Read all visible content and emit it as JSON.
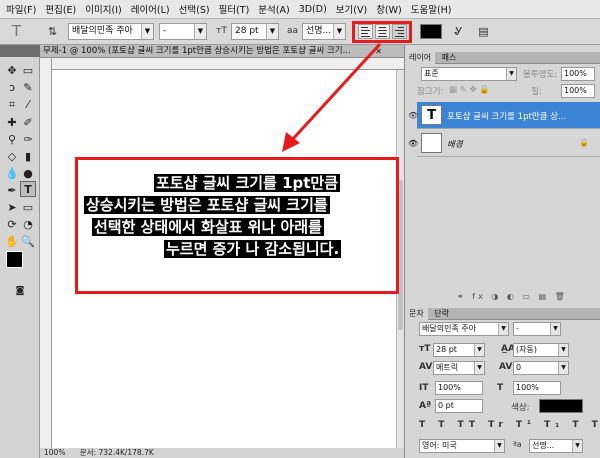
{
  "menu": [
    "파일(F)",
    "편집(E)",
    "이미지(I)",
    "레이어(L)",
    "선택(S)",
    "필터(T)",
    "분석(A)",
    "3D(D)",
    "보기(V)",
    "창(W)",
    "도움말(H)"
  ],
  "options_bar": {
    "font_family": "배달의민족 주아",
    "font_style": "-",
    "font_size": "28 pt",
    "aa_label": "a",
    "antialias": "선명...",
    "text_color": "#000000"
  },
  "document": {
    "tab_title": "무제-1 @ 100% (포토샵 글씨 크기를 1pt만큼 상승시키는 방법은 포토샵 글씨 크기...",
    "lines": [
      "포토샵 글씨 크기를 1pt만큼",
      "상승시키는 방법은 포토샵 글씨 크기를",
      "선택한 상태에서 화살표 위나 아래를",
      "누르면 증가 나 감소됩니다."
    ],
    "status_zoom": "100%",
    "status_doc": "문서: 732.4K/178.7K"
  },
  "layers_panel": {
    "tabs": [
      "레이어",
      "패스"
    ],
    "blend_mode": "표준",
    "opacity_label": "불투명도:",
    "opacity": "100%",
    "lock_label": "잠그기:",
    "fill_label": "칠:",
    "fill": "100%",
    "layers": [
      {
        "name": "포토샵 글씨 크기를 1pt만큼 상...",
        "type": "text",
        "selected": true
      },
      {
        "name": "배경",
        "type": "background",
        "selected": false
      }
    ]
  },
  "character_panel": {
    "tabs": [
      "문자",
      "단락"
    ],
    "font_family": "배달의민족 주아",
    "font_style": "-",
    "font_size": "28 pt",
    "leading": "(자동)",
    "kerning": "메트릭",
    "tracking": "0",
    "vertical_scale": "100%",
    "horizontal_scale": "100%",
    "baseline_shift": "0 pt",
    "color_label": "색상:",
    "color": "#000000",
    "language": "영어: 미국",
    "antialias": "선명..."
  },
  "colors": {
    "highlight": "#e61b1b",
    "selection_blue": "#3b84d6"
  }
}
